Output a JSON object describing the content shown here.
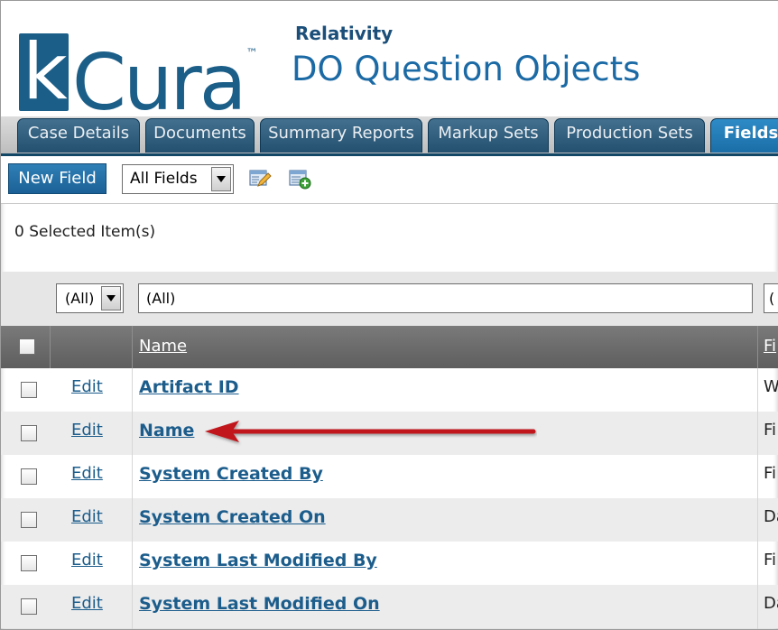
{
  "header": {
    "logo_text": "kCura",
    "logo_tm": "™",
    "app_name": "Relativity",
    "page_title": "DO Question Objects"
  },
  "tabs": [
    {
      "label": "Case Details"
    },
    {
      "label": "Documents"
    },
    {
      "label": "Summary Reports"
    },
    {
      "label": "Markup Sets"
    },
    {
      "label": "Production Sets"
    },
    {
      "label": "Fields",
      "active": true
    }
  ],
  "toolbar": {
    "new_button": "New Field",
    "view_select": "All Fields",
    "icons": [
      "edit-view-icon",
      "new-view-icon"
    ]
  },
  "selection": {
    "label": "0 Selected Item(s)"
  },
  "grid": {
    "filters": {
      "edit_filter": "(All)",
      "name_filter": "(All)",
      "type_filter": "("
    },
    "columns": {
      "name": "Name",
      "type": "Fi"
    },
    "rows": [
      {
        "edit": "Edit",
        "name": "Artifact ID",
        "type": "W"
      },
      {
        "edit": "Edit",
        "name": "Name",
        "type": "Fi"
      },
      {
        "edit": "Edit",
        "name": "System Created By",
        "type": "Fi"
      },
      {
        "edit": "Edit",
        "name": "System Created On",
        "type": "Da"
      },
      {
        "edit": "Edit",
        "name": "System Last Modified By",
        "type": "Fi"
      },
      {
        "edit": "Edit",
        "name": "System Last Modified On",
        "type": "Da"
      }
    ]
  },
  "colors": {
    "brand": "#1b5e88",
    "tab": "#2a5b7c",
    "tab_active": "#1b6ea7",
    "link": "#1c5d8c",
    "arrow": "#c0161b"
  }
}
